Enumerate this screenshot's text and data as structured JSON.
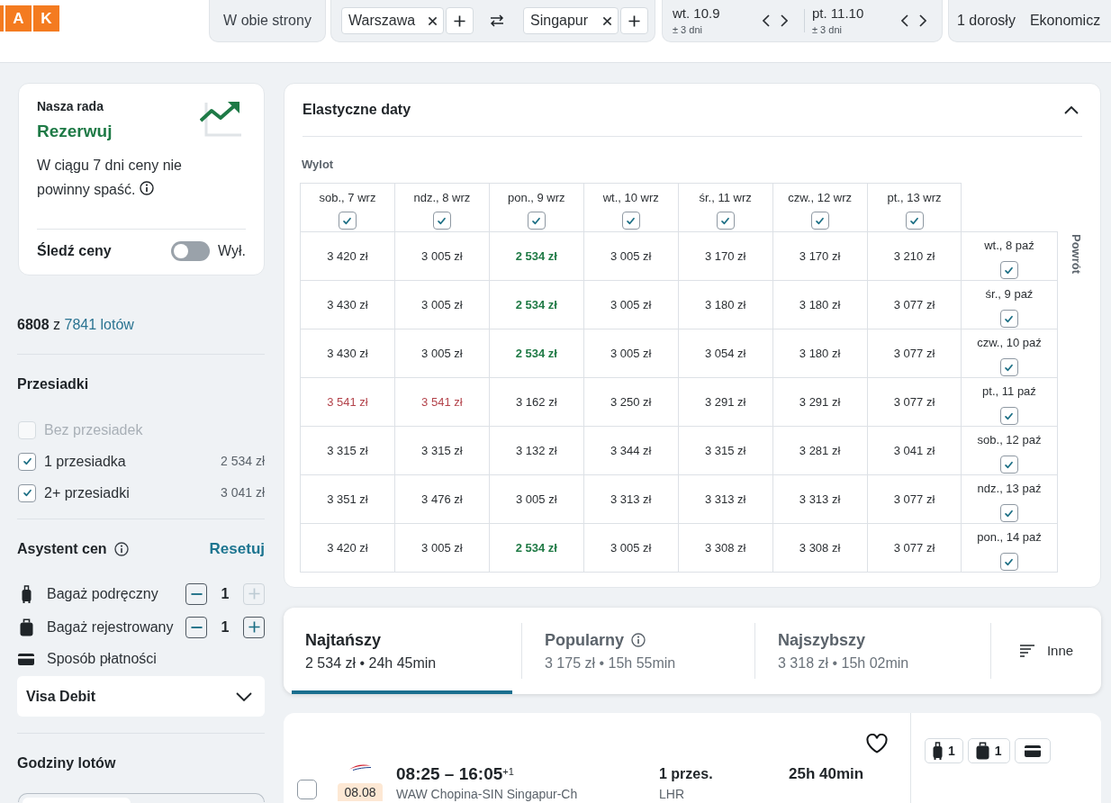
{
  "header": {
    "logo": [
      "A",
      "K"
    ],
    "trip_type": "W obie strony",
    "origin": "Warszawa",
    "destination": "Singapur",
    "dates": [
      {
        "date": "wt. 10.9",
        "flex": "± 3 dni"
      },
      {
        "date": "pt. 11.10",
        "flex": "± 3 dni"
      }
    ],
    "passengers": "1 dorosły",
    "cabin": "Ekonomicz"
  },
  "advice": {
    "label": "Nasza rada",
    "verdict": "Rezerwuj",
    "text": "W ciągu 7 dni ceny nie powinny spaść.",
    "track_label": "Śledź ceny",
    "track_on": false,
    "track_state": "Wył."
  },
  "results": {
    "shown": "6808",
    "joiner": "z",
    "total": "7841 lotów"
  },
  "stops": {
    "title": "Przesiadki",
    "options": [
      {
        "label": "Bez przesiadek",
        "checked": false,
        "disabled": true
      },
      {
        "label": "1 przesiadka",
        "price": "2 534 zł",
        "checked": true,
        "disabled": false
      },
      {
        "label": "2+ przesiadki",
        "price": "3 041 zł",
        "checked": true,
        "disabled": false
      }
    ]
  },
  "price_assistant": {
    "title": "Asystent cen",
    "reset": "Resetuj",
    "baggage": [
      {
        "kind": "cabin",
        "label": "Bagaż podręczny",
        "count": "1",
        "plus_disabled": true
      },
      {
        "kind": "checked",
        "label": "Bagaż rejestrowany",
        "count": "1",
        "plus_disabled": false
      }
    ],
    "payment_label": "Sposób płatności",
    "payment_method": "Visa Debit"
  },
  "flight_times": {
    "title": "Godziny lotów"
  },
  "flex_dates": {
    "title": "Elastyczne daty",
    "expanded": true,
    "outbound_label": "Wylot",
    "return_label": "Powrót",
    "outbound": [
      {
        "label": "sob., 7 wrz",
        "checked": true
      },
      {
        "label": "ndz., 8 wrz",
        "checked": true
      },
      {
        "label": "pon., 9 wrz",
        "checked": true
      },
      {
        "label": "wt., 10 wrz",
        "checked": true
      },
      {
        "label": "śr., 11 wrz",
        "checked": true
      },
      {
        "label": "czw., 12 wrz",
        "checked": true
      },
      {
        "label": "pt., 13 wrz",
        "checked": true
      }
    ],
    "rows": [
      {
        "return_date": "wt., 8 paź",
        "checked": true,
        "prices": [
          {
            "text": "3 420 zł",
            "cheapest": false,
            "expensive": false
          },
          {
            "text": "3 005 zł",
            "cheapest": false,
            "expensive": false
          },
          {
            "text": "2 534 zł",
            "cheapest": true,
            "expensive": false
          },
          {
            "text": "3 005 zł",
            "cheapest": false,
            "expensive": false
          },
          {
            "text": "3 170 zł",
            "cheapest": false,
            "expensive": false
          },
          {
            "text": "3 170 zł",
            "cheapest": false,
            "expensive": false
          },
          {
            "text": "3 210 zł",
            "cheapest": false,
            "expensive": false
          }
        ]
      },
      {
        "return_date": "śr., 9 paź",
        "checked": true,
        "prices": [
          {
            "text": "3 430 zł",
            "cheapest": false,
            "expensive": false
          },
          {
            "text": "3 005 zł",
            "cheapest": false,
            "expensive": false
          },
          {
            "text": "2 534 zł",
            "cheapest": true,
            "expensive": false
          },
          {
            "text": "3 005 zł",
            "cheapest": false,
            "expensive": false
          },
          {
            "text": "3 180 zł",
            "cheapest": false,
            "expensive": false
          },
          {
            "text": "3 180 zł",
            "cheapest": false,
            "expensive": false
          },
          {
            "text": "3 077 zł",
            "cheapest": false,
            "expensive": false
          }
        ]
      },
      {
        "return_date": "czw., 10 paź",
        "checked": true,
        "prices": [
          {
            "text": "3 430 zł",
            "cheapest": false,
            "expensive": false
          },
          {
            "text": "3 005 zł",
            "cheapest": false,
            "expensive": false
          },
          {
            "text": "2 534 zł",
            "cheapest": true,
            "expensive": false
          },
          {
            "text": "3 005 zł",
            "cheapest": false,
            "expensive": false
          },
          {
            "text": "3 054 zł",
            "cheapest": false,
            "expensive": false
          },
          {
            "text": "3 180 zł",
            "cheapest": false,
            "expensive": false
          },
          {
            "text": "3 077 zł",
            "cheapest": false,
            "expensive": false
          }
        ]
      },
      {
        "return_date": "pt., 11 paź",
        "checked": true,
        "prices": [
          {
            "text": "3 541 zł",
            "cheapest": false,
            "expensive": true
          },
          {
            "text": "3 541 zł",
            "cheapest": false,
            "expensive": true
          },
          {
            "text": "3 162 zł",
            "cheapest": false,
            "expensive": false
          },
          {
            "text": "3 250 zł",
            "cheapest": false,
            "expensive": false
          },
          {
            "text": "3 291 zł",
            "cheapest": false,
            "expensive": false
          },
          {
            "text": "3 291 zł",
            "cheapest": false,
            "expensive": false
          },
          {
            "text": "3 077 zł",
            "cheapest": false,
            "expensive": false
          }
        ]
      },
      {
        "return_date": "sob., 12 paź",
        "checked": true,
        "prices": [
          {
            "text": "3 315 zł",
            "cheapest": false,
            "expensive": false
          },
          {
            "text": "3 315 zł",
            "cheapest": false,
            "expensive": false
          },
          {
            "text": "3 132 zł",
            "cheapest": false,
            "expensive": false
          },
          {
            "text": "3 344 zł",
            "cheapest": false,
            "expensive": false
          },
          {
            "text": "3 315 zł",
            "cheapest": false,
            "expensive": false
          },
          {
            "text": "3 281 zł",
            "cheapest": false,
            "expensive": false
          },
          {
            "text": "3 041 zł",
            "cheapest": false,
            "expensive": false
          }
        ]
      },
      {
        "return_date": "ndz., 13 paź",
        "checked": true,
        "prices": [
          {
            "text": "3 351 zł",
            "cheapest": false,
            "expensive": false
          },
          {
            "text": "3 476 zł",
            "cheapest": false,
            "expensive": false
          },
          {
            "text": "3 005 zł",
            "cheapest": false,
            "expensive": false
          },
          {
            "text": "3 313 zł",
            "cheapest": false,
            "expensive": false
          },
          {
            "text": "3 313 zł",
            "cheapest": false,
            "expensive": false
          },
          {
            "text": "3 313 zł",
            "cheapest": false,
            "expensive": false
          },
          {
            "text": "3 077 zł",
            "cheapest": false,
            "expensive": false
          }
        ]
      },
      {
        "return_date": "pon., 14 paź",
        "checked": true,
        "prices": [
          {
            "text": "3 420 zł",
            "cheapest": false,
            "expensive": false
          },
          {
            "text": "3 005 zł",
            "cheapest": false,
            "expensive": false
          },
          {
            "text": "2 534 zł",
            "cheapest": true,
            "expensive": false
          },
          {
            "text": "3 005 zł",
            "cheapest": false,
            "expensive": false
          },
          {
            "text": "3 308 zł",
            "cheapest": false,
            "expensive": false
          },
          {
            "text": "3 308 zł",
            "cheapest": false,
            "expensive": false
          },
          {
            "text": "3 077 zł",
            "cheapest": false,
            "expensive": false
          }
        ]
      }
    ]
  },
  "sort_tabs": [
    {
      "title": "Najtańszy",
      "summary": "2 534 zł • 24h 45min",
      "info": false,
      "selected": true
    },
    {
      "title": "Popularny",
      "summary": "3 175 zł • 15h 55min",
      "info": true,
      "selected": false
    },
    {
      "title": "Najszybszy",
      "summary": "3 318 zł • 15h 02min",
      "info": false,
      "selected": false
    }
  ],
  "sort_more": "Inne",
  "flight": {
    "checked": false,
    "date_badge": "08.08",
    "times": "08:25 – 16:05$^{+1}$",
    "route": "WAW Chopina-SIN Singapur-Ch",
    "stops": "1 przes.",
    "via": "LHR",
    "duration": "25h 40min",
    "favorite": false,
    "extras": [
      {
        "kind": "cabin",
        "count": "1"
      },
      {
        "kind": "checked",
        "count": "1"
      },
      {
        "kind": "payment"
      }
    ]
  }
}
